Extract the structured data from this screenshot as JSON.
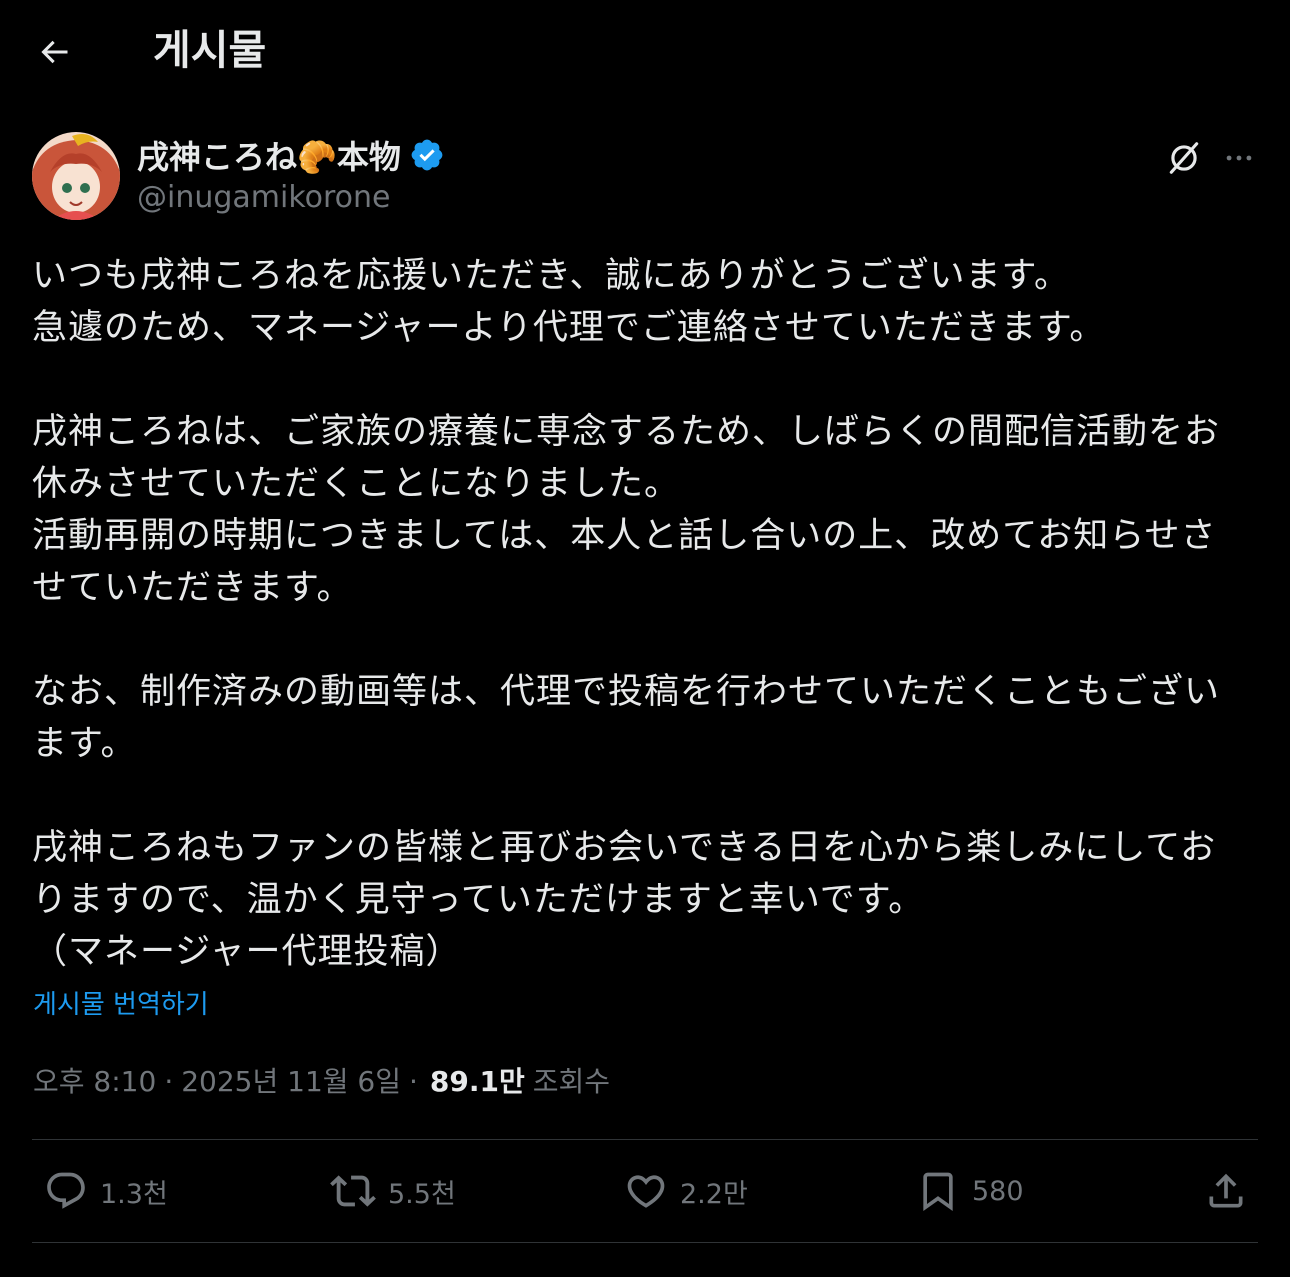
{
  "header": {
    "title": "게시물",
    "back_icon": "arrow-left-icon"
  },
  "author": {
    "display_name": "戌神ころね",
    "name_emoji": "🥐",
    "name_suffix": "本物",
    "handle": "@inugamikorone",
    "verified": true,
    "verified_color": "#1d9bf0"
  },
  "tweet": {
    "paragraphs": [
      [
        "いつも戌神ころねを応援いただき、誠にありがとうございます。",
        "急遽のため、マネージャーより代理でご連絡させていただきます。"
      ],
      [
        "戌神ころねは、ご家族の療養に専念するため、しばらくの間配信活動をお",
        "休みさせていただくことになりました。",
        "活動再開の時期につきましては、本人と話し合いの上、改めてお知らせさ",
        "せていただきます。"
      ],
      [
        "なお、制作済みの動画等は、代理で投稿を行わせていただくこともござい",
        "ます。"
      ],
      [
        "戌神ころねもファンの皆様と再びお会いできる日を心から楽しみにしてお",
        "りますので、温かく見守っていただけますと幸いです。",
        "（マネージャー代理投稿）"
      ]
    ],
    "translate_label": "게시물 번역하기"
  },
  "meta": {
    "time": "오후 8:10",
    "separator": "·",
    "date": "2025년 11월 6일",
    "views_count": "89.1만",
    "views_label": "조회수"
  },
  "actions": {
    "reply_count": "1.3천",
    "repost_count": "5.5천",
    "like_count": "2.2만",
    "bookmark_count": "580"
  },
  "colors": {
    "background": "#000000",
    "text": "#e7e9ea",
    "secondary": "#71767b",
    "accent": "#1d9bf0",
    "divider": "#2f3336"
  }
}
